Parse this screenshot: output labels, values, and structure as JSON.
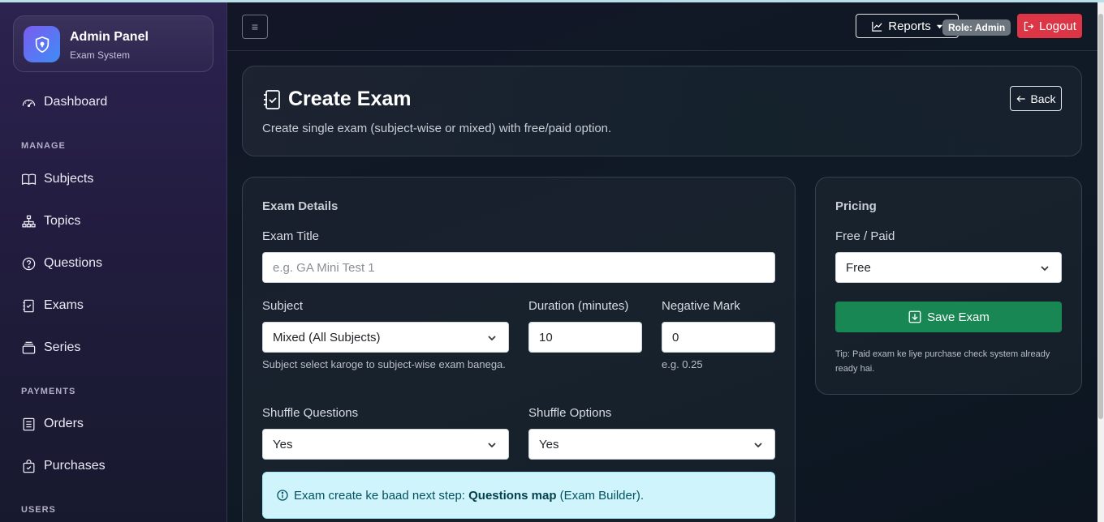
{
  "brand": {
    "title": "Admin Panel",
    "subtitle": "Exam System"
  },
  "sidebar": {
    "dashboard": "Dashboard",
    "sections": {
      "manage": "MANAGE",
      "payments": "PAYMENTS",
      "users": "USERS"
    },
    "items": [
      {
        "label": "Subjects",
        "icon": "book-icon"
      },
      {
        "label": "Topics",
        "icon": "hierarchy-icon"
      },
      {
        "label": "Questions",
        "icon": "question-icon"
      },
      {
        "label": "Exams",
        "icon": "checklist-icon"
      },
      {
        "label": "Series",
        "icon": "stack-icon"
      },
      {
        "label": "Orders",
        "icon": "receipt-icon"
      },
      {
        "label": "Purchases",
        "icon": "bag-check-icon"
      }
    ]
  },
  "topbar": {
    "menu_glyph": "≡",
    "reports": "Reports",
    "role": "Role: Admin",
    "logout": "Logout"
  },
  "header": {
    "title": "Create Exam",
    "subtitle": "Create single exam (subject-wise or mixed) with free/paid option.",
    "back": "Back"
  },
  "details": {
    "title": "Exam Details",
    "exam_title_label": "Exam Title",
    "exam_title_placeholder": "e.g. GA Mini Test 1",
    "subject_label": "Subject",
    "subject_value": "Mixed (All Subjects)",
    "subject_help": "Subject select karoge to subject-wise exam banega.",
    "duration_label": "Duration (minutes)",
    "duration_value": "10",
    "negative_label": "Negative Mark",
    "negative_value": "0",
    "negative_help": "e.g. 0.25",
    "shuffle_q_label": "Shuffle Questions",
    "shuffle_q_value": "Yes",
    "shuffle_o_label": "Shuffle Options",
    "shuffle_o_value": "Yes",
    "info_prefix": "Exam create ke baad next step: ",
    "info_bold": "Questions map",
    "info_suffix": " (Exam Builder)."
  },
  "pricing": {
    "title": "Pricing",
    "type_label": "Free / Paid",
    "type_value": "Free",
    "save": "Save Exam",
    "tip": "Tip: Paid exam ke liye purchase check system already ready hai."
  },
  "colors": {
    "danger": "#dc3545",
    "success": "#198754",
    "info_bg": "#cff4fc",
    "accent_start": "#7a5cf0",
    "accent_end": "#3f8cf5"
  }
}
